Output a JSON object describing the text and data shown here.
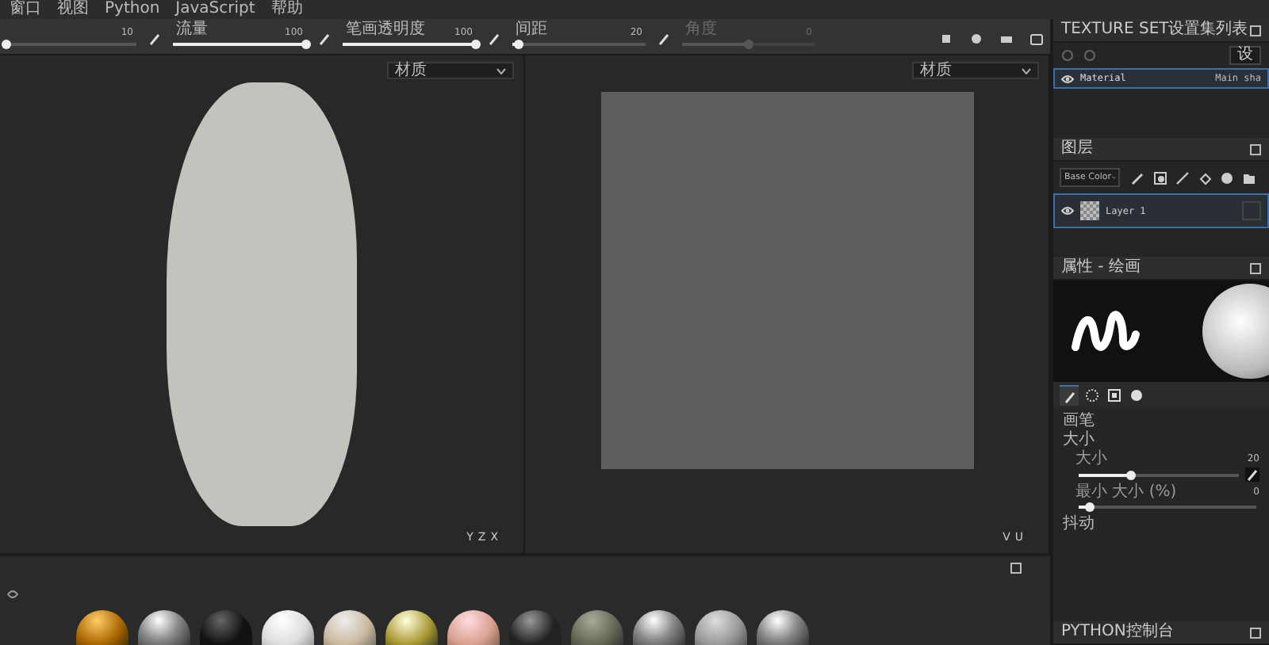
{
  "menu": [
    {
      "label": "窗口"
    },
    {
      "label": "视图"
    },
    {
      "label": "Python"
    },
    {
      "label": "JavaScript"
    },
    {
      "label": "帮助"
    }
  ],
  "toolbar": {
    "sliders": [
      {
        "reading": "10",
        "level": 0.02,
        "disabled": false
      },
      {
        "label": "流量",
        "reading": "100",
        "level": 1.0,
        "disabled": false
      },
      {
        "label": "笔画透明度",
        "reading": "100",
        "level": 1.0,
        "disabled": false
      },
      {
        "label": "间距",
        "reading": "20",
        "level": 0.05,
        "disabled": false
      },
      {
        "label": "角度",
        "reading": "0",
        "level": 0.5,
        "disabled": true
      }
    ]
  },
  "viewports": [
    {
      "kind": "model",
      "dropdown": "材质",
      "axes": [
        "Y",
        "Z",
        "X"
      ]
    },
    {
      "kind": "uv",
      "dropdown": "材质",
      "axes": [
        "V",
        "U"
      ]
    }
  ],
  "texture_sets": {
    "title": "TEXTURE SET设置集列表",
    "button": "设",
    "items": [
      {
        "name": "Material",
        "shader": "Main sha",
        "selected": true
      }
    ]
  },
  "layers": {
    "title": "图层",
    "channel": "Base Color",
    "items": [
      {
        "name": "Layer 1",
        "visible": true,
        "selected": true
      }
    ]
  },
  "properties": {
    "title": "属性 - 绘画",
    "tool_tabs": [
      {
        "selected": true
      },
      {
        "selected": false
      },
      {
        "selected": false
      },
      {
        "selected": false
      }
    ],
    "section": "画笔",
    "group": "大小",
    "params": [
      {
        "label": "大小",
        "reading": "20",
        "level": 0.33
      },
      {
        "label": "最小 大小 (%)",
        "reading": "0",
        "level": 0.06
      }
    ],
    "next_group": "抖动"
  },
  "console": {
    "title": "PYTHON控制台"
  }
}
